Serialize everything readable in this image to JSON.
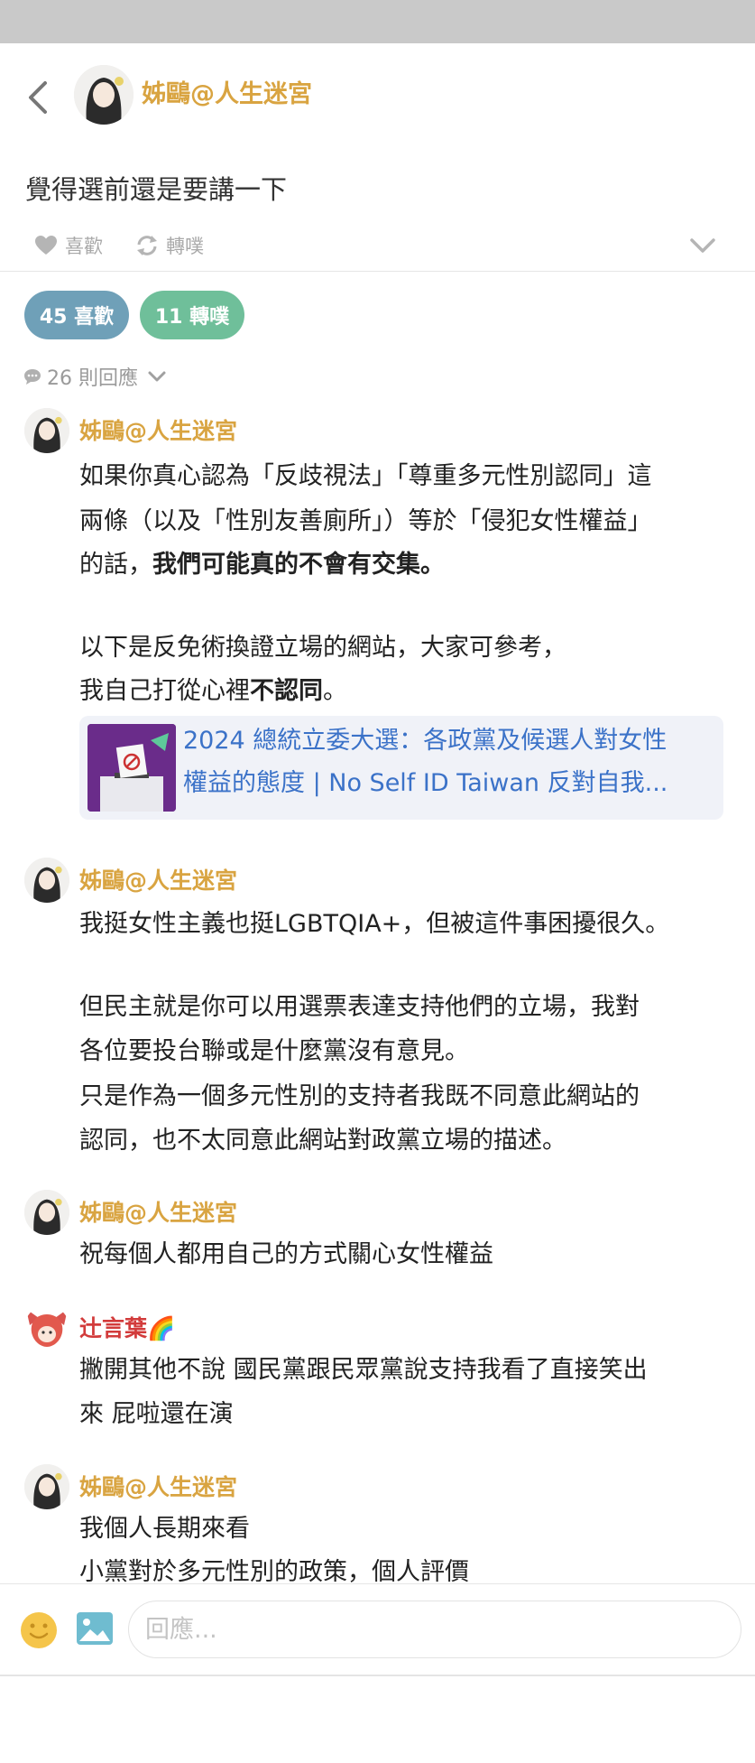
{
  "header": {
    "author": "姊鷗@人生迷宮"
  },
  "post": {
    "text": "覺得選前還是要講一下",
    "like_label": "喜歡",
    "repost_label": "轉噗"
  },
  "stats": {
    "likes_label": "45 喜歡",
    "reposts_label": "11 轉噗",
    "responses_label": "26 則回應"
  },
  "comments": [
    {
      "author": "姊鷗@人生迷宮",
      "lines": [
        "如果你真心認為「反歧視法」「尊重多元性別認同」這",
        "兩條（以及「性別友善廁所」）等於「侵犯女性權益」",
        "的話，",
        "我們可能真的不會有交集。",
        "以下是反免術換證立場的網站，大家可參考，",
        "我自己打從心裡",
        "不認同",
        "。"
      ],
      "link": {
        "line1": "2024 總統立委大選：各政黨及候選人對女性",
        "line2": "權益的態度 | No Self ID Taiwan 反對自我..."
      }
    },
    {
      "author": "姊鷗@人生迷宮",
      "lines": [
        "我挺女性主義也挺LGBTQIA+，但被這件事困擾很久。",
        "但民主就是你可以用選票表達支持他們的立場，我對",
        "各位要投台聯或是什麼黨沒有意見。",
        "只是作為一個多元性別的支持者我既不同意此網站的",
        "認同，也不太同意此網站對政黨立場的描述。"
      ]
    },
    {
      "author": "姊鷗@人生迷宮",
      "lines": [
        "祝每個人都用自己的方式關心女性權益"
      ]
    },
    {
      "author": "辻言葉🌈",
      "lines": [
        "撇開其他不說 國民黨跟民眾黨說支持我看了直接笑出",
        "來 屁啦還在演"
      ]
    },
    {
      "author": "姊鷗@人生迷宮",
      "lines": [
        "我個人長期來看",
        "小黨對於多元性別的政策，個人評價"
      ]
    }
  ],
  "composer": {
    "placeholder": "回應..."
  },
  "colors": {
    "author_gold": "#d9a441",
    "author_red": "#d23b3b",
    "likes_pill": "#6fa0b8",
    "reposts_pill": "#6fbf9a",
    "link_blue": "#3b72c8"
  }
}
